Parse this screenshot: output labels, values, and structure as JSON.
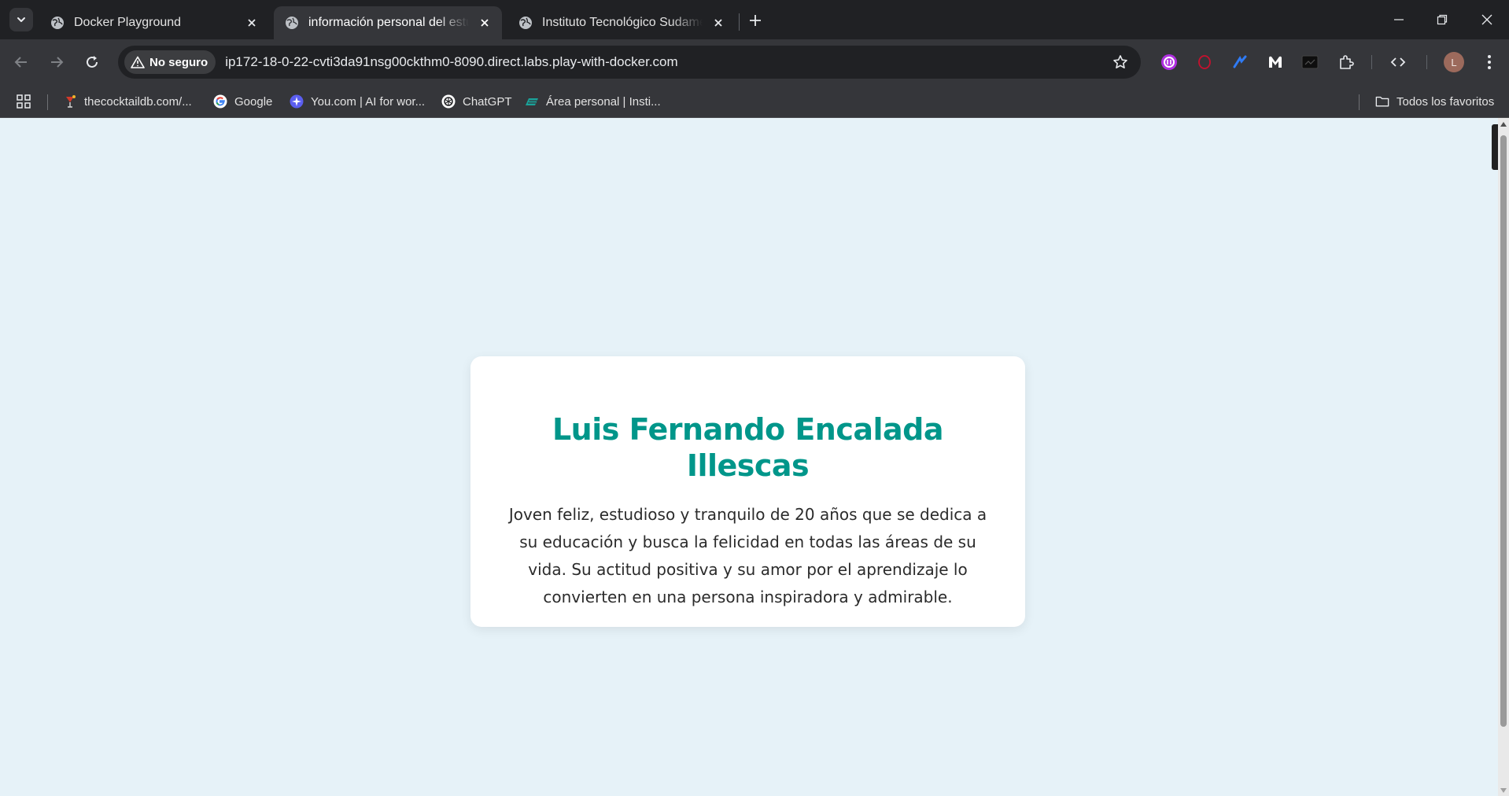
{
  "browser": {
    "tabs": [
      {
        "title": "Docker Playground",
        "active": false
      },
      {
        "title": "información personal del estudiante",
        "active": true
      },
      {
        "title": "Instituto Tecnológico Sudamericano",
        "active": false
      }
    ],
    "address_bar": {
      "security_label": "No seguro",
      "url": "ip172-18-0-22-cvti3da91nsg00ckthm0-8090.direct.labs.play-with-docker.com"
    },
    "profile_initial": "L",
    "bookmarks": [
      {
        "label": "thecocktaildb.com/...",
        "icon": "cocktail-icon"
      },
      {
        "label": "Google",
        "icon": "google-icon"
      },
      {
        "label": "You.com | AI for wor...",
        "icon": "youcom-icon"
      },
      {
        "label": "ChatGPT",
        "icon": "chatgpt-icon"
      },
      {
        "label": "Área personal | Insti...",
        "icon": "moodle-icon"
      }
    ],
    "all_bookmarks_label": "Todos los favoritos",
    "colors": {
      "accent": "#00968a",
      "page_bg": "#e6f2f8"
    }
  },
  "page": {
    "name": "Luis Fernando Encalada Illescas",
    "description": "Joven feliz, estudioso y tranquilo de 20 años que se dedica a su educación y busca la felicidad en todas las áreas de su vida. Su actitud positiva y su amor por el aprendizaje lo convierten en una persona inspiradora y admirable."
  }
}
